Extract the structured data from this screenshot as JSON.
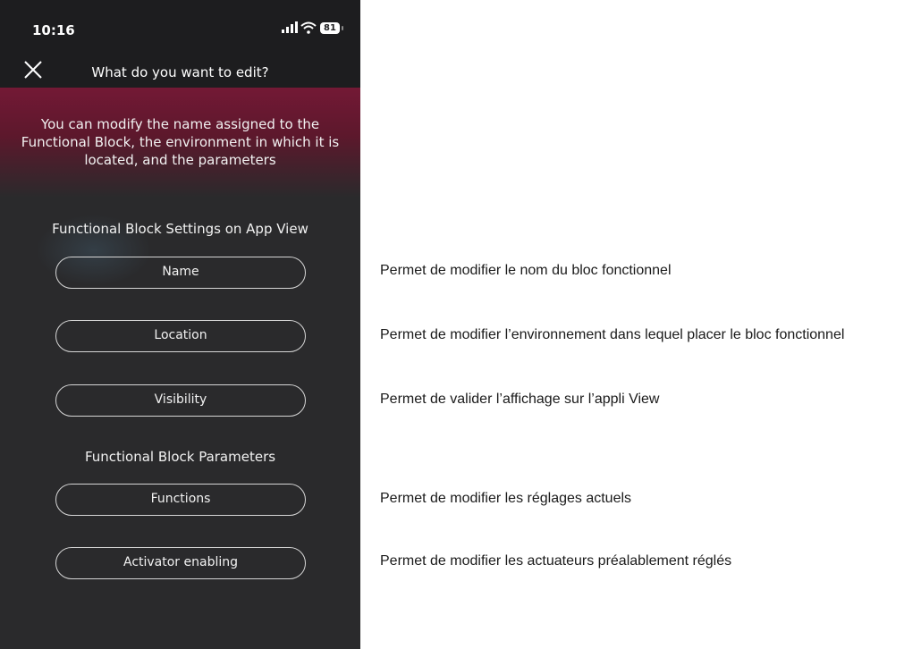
{
  "status_bar": {
    "time": "10:16",
    "battery": "81",
    "signal_icon": "signal-icon",
    "wifi_icon": "wifi-icon"
  },
  "header": {
    "title": "What do you want to edit?",
    "close_icon": "close-icon"
  },
  "intro": "You can modify the name assigned to the Functional Block, the environment in which it is located, and the parameters",
  "sections": {
    "settings_title": "Functional Block Settings on App View",
    "parameters_title": "Functional Block Parameters"
  },
  "buttons": {
    "name": "Name",
    "location": "Location",
    "visibility": "Visibility",
    "functions": "Functions",
    "activator_enabling": "Activator enabling"
  },
  "annotations": {
    "name": "Permet de modifier le nom du bloc fonctionnel",
    "location": "Permet de modifier l’environnement dans lequel placer le bloc fonctionnel",
    "visibility": "Permet de valider l’affichage sur l’appli View",
    "functions": "Permet de modifier les réglages actuels",
    "activator_enabling": "Permet de modifier les actuateurs préalablement réglés"
  },
  "colors": {
    "accent": "#7a1836",
    "background": "#2a2a2c",
    "status_bar": "#1d1d1f"
  }
}
